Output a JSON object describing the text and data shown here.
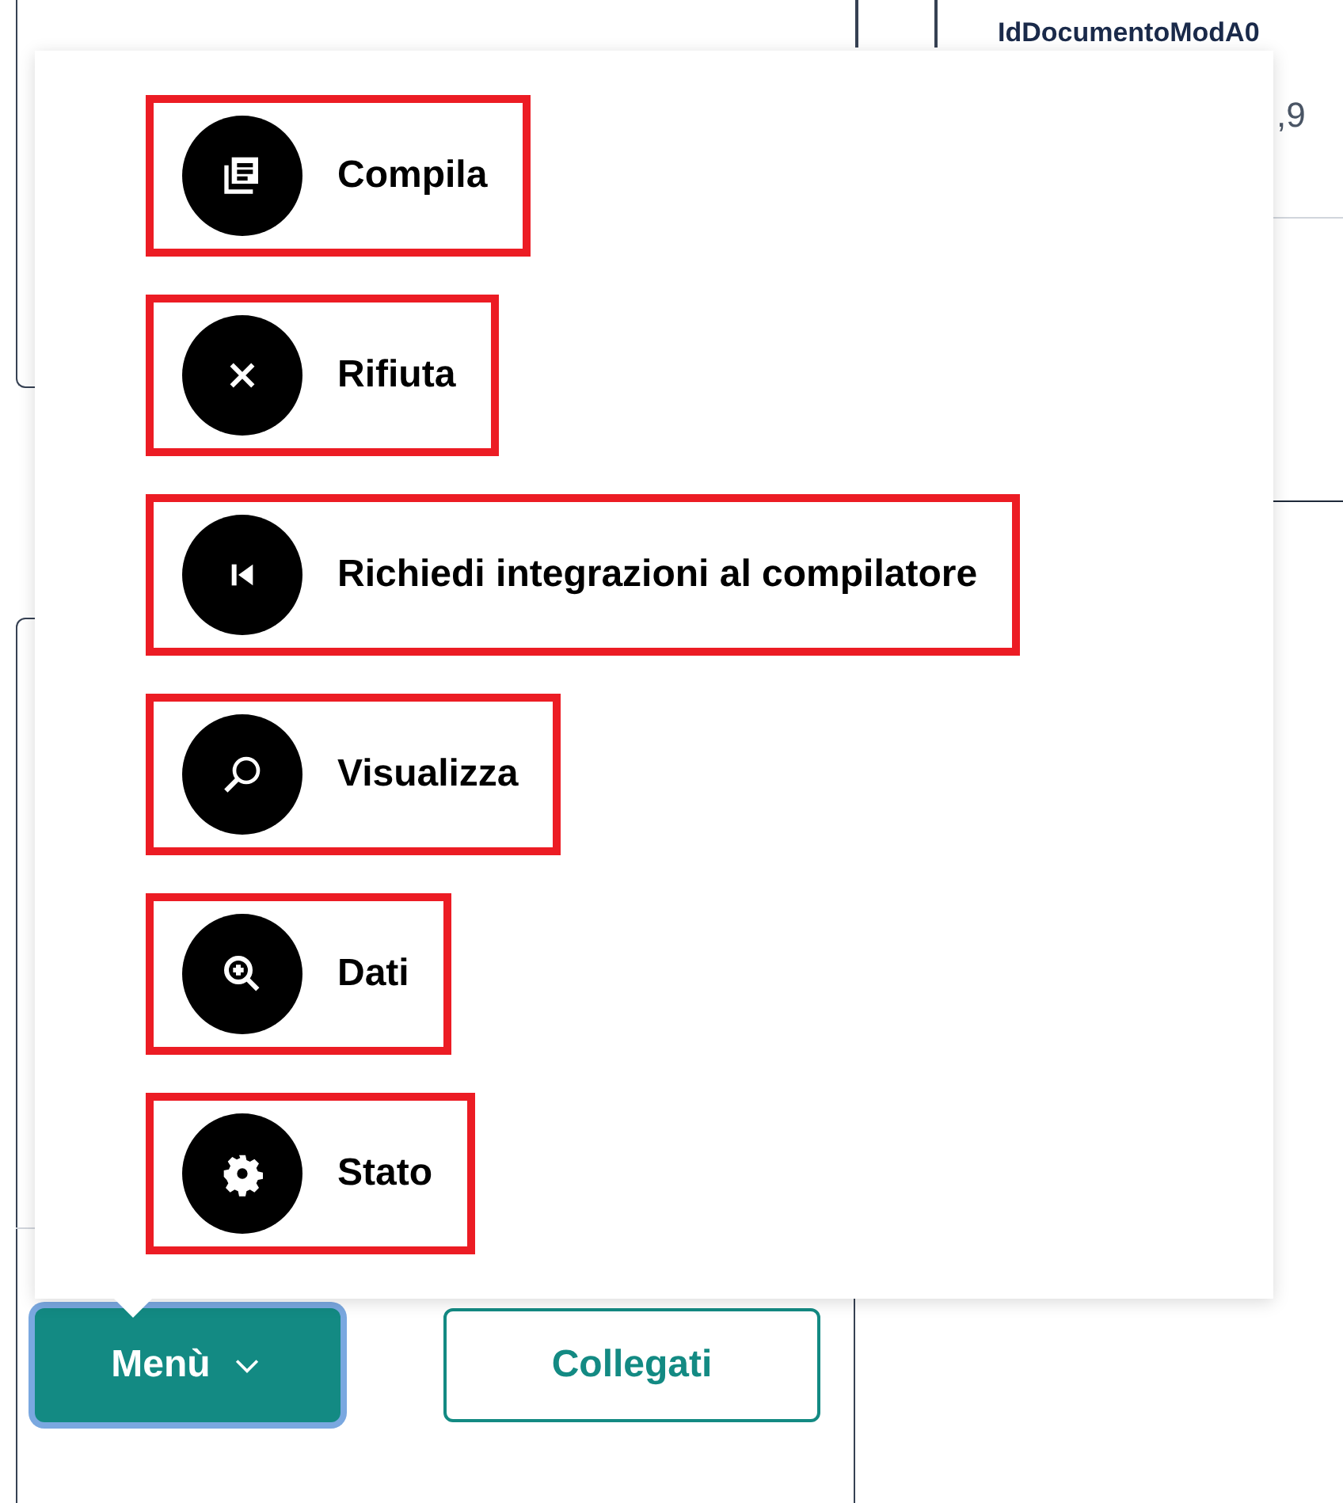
{
  "table_header": {
    "column_3": "IdDocumentoModA0"
  },
  "table_value": ",9",
  "menu_popup": {
    "items": [
      {
        "label": "Compila",
        "highlighted": true
      },
      {
        "label": "Rifiuta",
        "highlighted": true
      },
      {
        "label": "Richiedi integrazioni al compilatore",
        "highlighted": true
      },
      {
        "label": "Visualizza",
        "highlighted": true
      },
      {
        "label": "Dati",
        "highlighted": true
      },
      {
        "label": "Stato",
        "highlighted": true
      }
    ]
  },
  "buttons": {
    "menu": {
      "label": "Menù",
      "focused": true
    },
    "collegati": {
      "label": "Collegati"
    }
  }
}
